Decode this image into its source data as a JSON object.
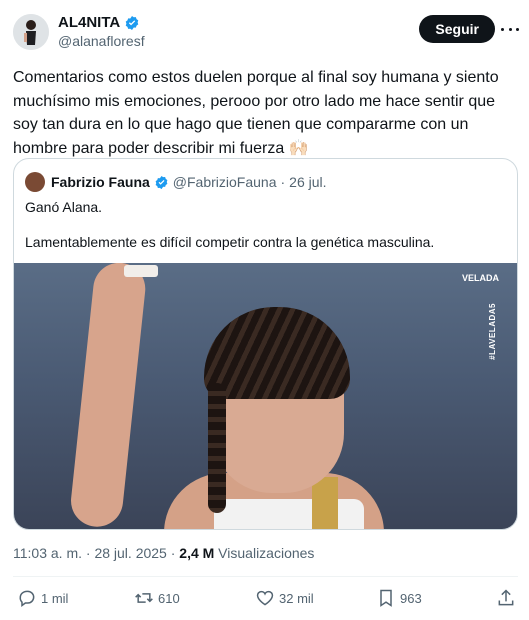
{
  "author": {
    "name": "AL4NITA",
    "handle": "@alanafloresf",
    "verified": true
  },
  "follow_label": "Seguir",
  "tweet_text": "Comentarios como estos duelen porque al final soy humana y siento muchísimo mis emociones, perooo por otro lado me hace sentir que soy tan dura en lo que hago que tienen que compararme con un hombre para poder describir mi fuerza 🙌🏻",
  "quoted": {
    "name": "Fabrizio Fauna",
    "handle": "@FabrizioFauna",
    "separator": "·",
    "date": "26 jul.",
    "line1": "Ganó Alana.",
    "line2": "Lamentablemente es difícil competir contra la genética masculina.",
    "image_watermark": "VELADA",
    "image_hashtag": "#LAVELADA5"
  },
  "meta": {
    "time_date": "11:03 a. m. · 28 jul. 2025 · ",
    "views_count": "2,4 M",
    "views_label": " Visualizaciones"
  },
  "actions": [
    {
      "icon": "reply-icon",
      "count": "1 mil"
    },
    {
      "icon": "repost-icon",
      "count": "610"
    },
    {
      "icon": "like-icon",
      "count": "32 mil"
    },
    {
      "icon": "bookmark-icon",
      "count": "963"
    },
    {
      "icon": "share-icon",
      "count": ""
    }
  ],
  "colors": {
    "verified": "#1d9bf0",
    "text": "#0f1419",
    "secondary": "#536471",
    "border": "#cfd9de"
  }
}
